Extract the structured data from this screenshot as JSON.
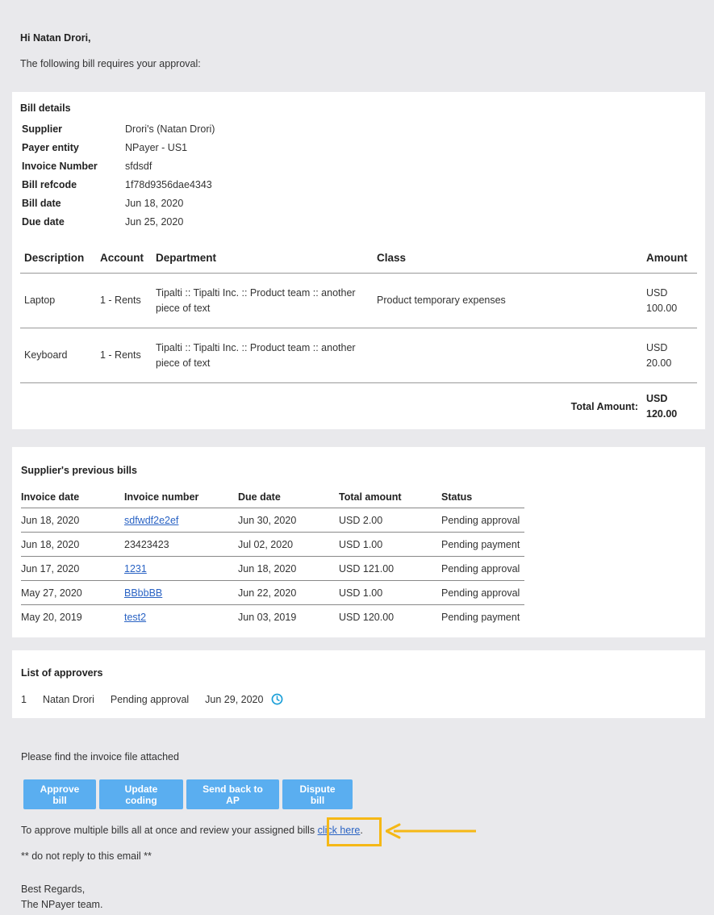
{
  "greeting": {
    "hi": "Hi Natan Drori,",
    "intro": "The following bill requires your approval:"
  },
  "bill": {
    "title": "Bill details",
    "fields": [
      {
        "label": "Supplier",
        "value": "Drori's (Natan Drori)"
      },
      {
        "label": "Payer entity",
        "value": "NPayer - US1"
      },
      {
        "label": "Invoice Number",
        "value": "sfdsdf"
      },
      {
        "label": "Bill refcode",
        "value": "1f78d9356dae4343"
      },
      {
        "label": "Bill date",
        "value": "Jun 18, 2020"
      },
      {
        "label": "Due date",
        "value": "Jun 25, 2020"
      }
    ],
    "columns": [
      "Description",
      "Account",
      "Department",
      "Class",
      "Amount"
    ],
    "lines": [
      {
        "description": "Laptop",
        "account": "1 - Rents",
        "department": "Tipalti :: Tipalti Inc. :: Product team :: another piece of text",
        "class": "Product temporary expenses",
        "currency": "USD",
        "amount": "100.00"
      },
      {
        "description": "Keyboard",
        "account": "1 - Rents",
        "department": "Tipalti :: Tipalti Inc. :: Product team :: another piece of text",
        "class": "",
        "currency": "USD",
        "amount": "20.00"
      }
    ],
    "total_label": "Total Amount:",
    "total_currency": "USD",
    "total_amount": "120.00"
  },
  "previous": {
    "title": "Supplier's previous bills",
    "columns": [
      "Invoice date",
      "Invoice number",
      "Due date",
      "Total amount",
      "Status"
    ],
    "rows": [
      {
        "invoice_date": "Jun 18, 2020",
        "invoice_number": "sdfwdf2e2ef",
        "link": true,
        "due_date": "Jun 30, 2020",
        "total": "USD 2.00",
        "status": "Pending approval"
      },
      {
        "invoice_date": "Jun 18, 2020",
        "invoice_number": "23423423",
        "link": false,
        "due_date": "Jul 02, 2020",
        "total": "USD 1.00",
        "status": "Pending payment"
      },
      {
        "invoice_date": "Jun 17, 2020",
        "invoice_number": "1231",
        "link": true,
        "due_date": "Jun 18, 2020",
        "total": "USD 121.00",
        "status": "Pending approval"
      },
      {
        "invoice_date": "May 27, 2020",
        "invoice_number": "BBbbBB",
        "link": true,
        "due_date": "Jun 22, 2020",
        "total": "USD 1.00",
        "status": "Pending approval"
      },
      {
        "invoice_date": "May 20, 2019",
        "invoice_number": "test2",
        "link": true,
        "due_date": "Jun 03, 2019",
        "total": "USD 120.00",
        "status": "Pending payment"
      }
    ]
  },
  "approvers": {
    "title": "List of approvers",
    "items": [
      {
        "index": "1",
        "name": "Natan Drori",
        "status": "Pending approval",
        "date": "Jun 29, 2020",
        "icon": "clock-icon"
      }
    ]
  },
  "footer": {
    "attach_note": "Please find the invoice file attached",
    "buttons": [
      "Approve bill",
      "Update coding",
      "Send back to AP",
      "Dispute bill"
    ],
    "multi_text": "To approve multiple bills all at once and review your assigned bills ",
    "multi_link": "click here",
    "multi_end": ".",
    "noreply": "** do not reply to this email **",
    "regards": "Best Regards,",
    "team": "The NPayer team."
  },
  "colors": {
    "button": "#5aaef0",
    "link": "#2a63c4",
    "highlight": "#f5b816",
    "clock": "#1a9fd8"
  }
}
